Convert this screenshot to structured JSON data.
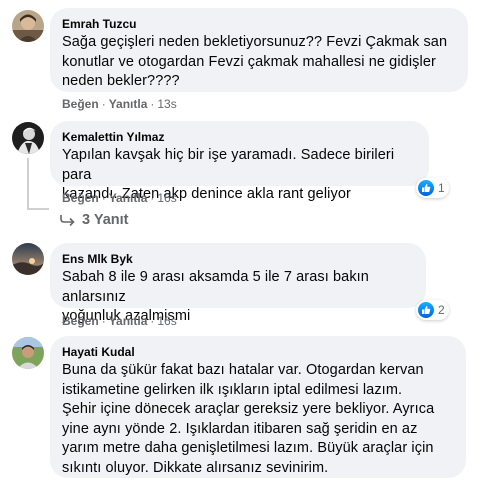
{
  "comments": [
    {
      "author": "Emrah Tuzcu",
      "lines": [
        "Sağa geçişleri neden bekletiyorsunuz?? Fevzi Çakmak san",
        "konutlar ve otogardan Fevzi çakmak mahallesi ne gidişler",
        "neden bekler????"
      ],
      "like_label": "Beğen",
      "reply_label": "Yanıtla",
      "time": "13s"
    },
    {
      "author": "Kemalettin Yılmaz",
      "lines": [
        "Yapılan kavşak hiç bir işe yaramadı. Sadece birileri para",
        "kazandı. Zaten akp denince akla rant geliyor"
      ],
      "like_label": "Beğen",
      "reply_label": "Yanıtla",
      "time": "16s",
      "reaction_count": "1",
      "replies_label": "3 Yanıt"
    },
    {
      "author": "Ens Mlk Byk",
      "lines": [
        "Sabah 8 ile 9 arası aksamda 5 ile 7 arası bakın anlarsınız",
        "yoğunluk azalmismi"
      ],
      "like_label": "Beğen",
      "reply_label": "Yanıtla",
      "time": "16s",
      "reaction_count": "2"
    },
    {
      "author": "Hayati Kudal",
      "lines": [
        "Buna da şükür fakat bazı hatalar var. Otogardan kervan",
        "istikametine gelirken ilk ışıkların iptal edilmesi lazım.",
        "Şehir içine dönecek araçlar gereksiz yere bekliyor. Ayrıca",
        "yine aynı yönde 2. Işıklardan itibaren sağ şeridin en az",
        "yarım metre daha genişletilmesi lazım. Büyük araçlar için",
        "sıkıntı oluyor. Dikkate alırsanız sevinirim."
      ]
    }
  ],
  "colors": {
    "bubble": "#f0f2f5",
    "secondary_text": "#65676b",
    "like_blue": "#1877f2"
  },
  "icons": {
    "reaction": "thumbs-up-icon",
    "replies": "reply-arrow-icon"
  }
}
